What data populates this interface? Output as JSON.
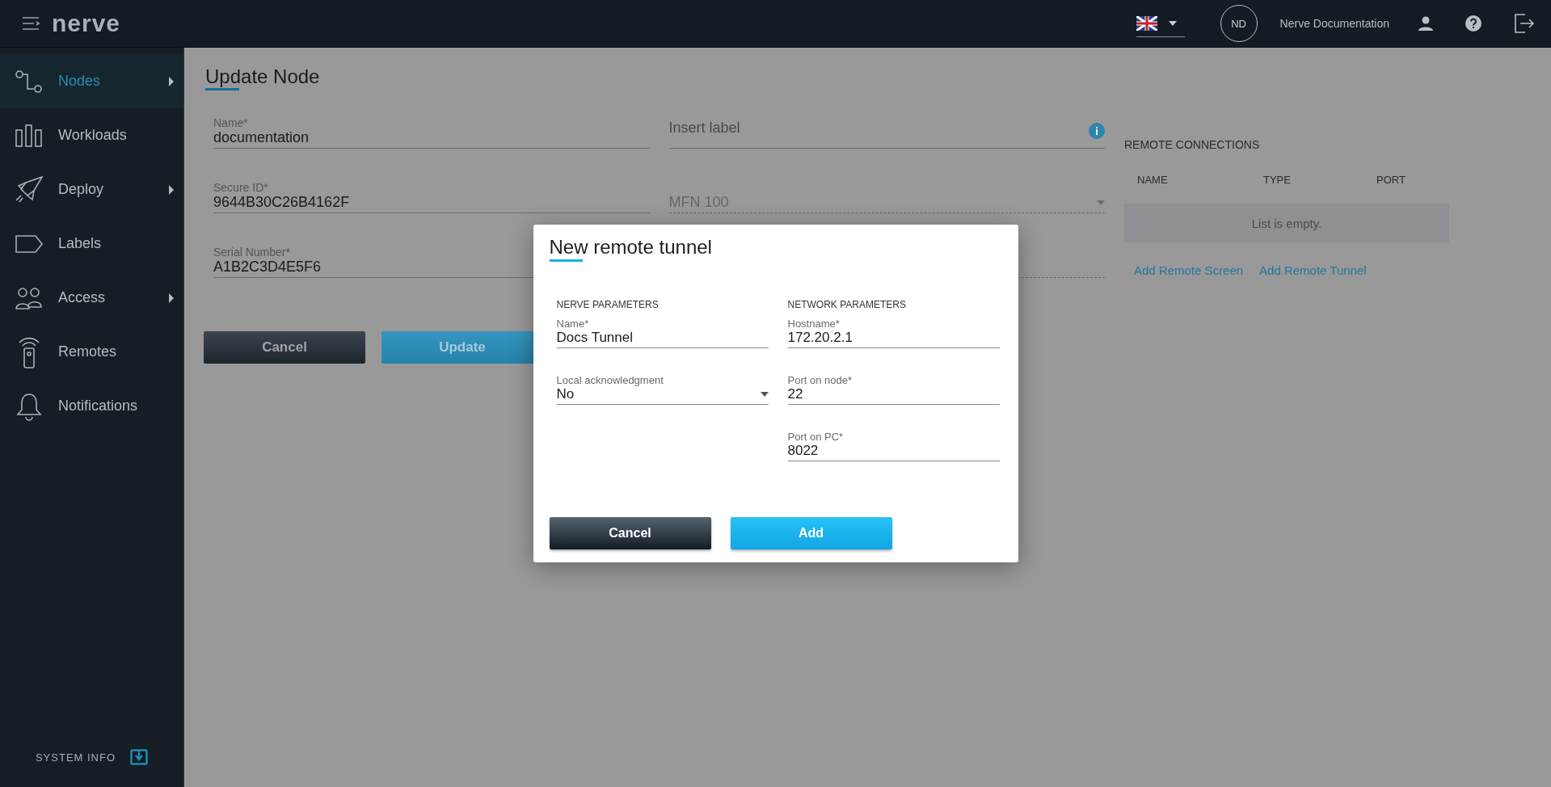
{
  "topbar": {
    "logo": "nerve",
    "language": {
      "expanded": false
    },
    "avatar": "ND",
    "user": "Nerve Documentation"
  },
  "sidebar": {
    "items": [
      {
        "label": "Nodes",
        "selected": true,
        "submenu": true
      },
      {
        "label": "Workloads",
        "selected": false,
        "submenu": false
      },
      {
        "label": "Deploy",
        "selected": false,
        "submenu": true
      },
      {
        "label": "Labels",
        "selected": false,
        "submenu": false
      },
      {
        "label": "Access",
        "selected": false,
        "submenu": true
      },
      {
        "label": "Remotes",
        "selected": false,
        "submenu": false
      },
      {
        "label": "Notifications",
        "selected": false,
        "submenu": false
      }
    ],
    "system_info": "SYSTEM INFO"
  },
  "page": {
    "title": "Update Node",
    "left_fields": [
      {
        "label": "Name*",
        "value": "documentation",
        "disabled": false
      },
      {
        "label": "Secure ID*",
        "value": "9644B30C26B4162F",
        "disabled": false
      },
      {
        "label": "Serial Number*",
        "value": "A1B2C3D4E5F6",
        "disabled": false
      }
    ],
    "right_fields": [
      {
        "kind": "info",
        "placeholder": "Insert label"
      },
      {
        "kind": "select",
        "value": "MFN 100",
        "disabled": true
      },
      {
        "kind": "text",
        "disabled": true
      }
    ],
    "buttons": [
      {
        "kind": "secondary",
        "label": "Cancel"
      },
      {
        "kind": "primary",
        "label": "Update"
      }
    ]
  },
  "remote_connections": {
    "title": "REMOTE CONNECTIONS",
    "columns": [
      "NAME",
      "TYPE",
      "PORT"
    ],
    "empty": "List is empty.",
    "links": [
      "Add Remote Screen",
      "Add Remote Tunnel"
    ]
  },
  "dialog": {
    "title": "New remote tunnel",
    "sections": [
      {
        "heading": "NERVE PARAMETERS",
        "fields": [
          {
            "kind": "text",
            "label": "Name*",
            "value": "Docs Tunnel"
          },
          {
            "kind": "select",
            "label": "Local acknowledgment",
            "value": "No"
          }
        ]
      },
      {
        "heading": "NETWORK PARAMETERS",
        "fields": [
          {
            "kind": "text",
            "label": "Hostname*",
            "value": "172.20.2.1"
          },
          {
            "kind": "text",
            "label": "Port on node*",
            "value": "22"
          },
          {
            "kind": "text",
            "label": "Port on PC*",
            "value": "8022"
          }
        ]
      }
    ],
    "buttons": [
      {
        "kind": "secondary",
        "label": "Cancel"
      },
      {
        "kind": "primary",
        "label": "Add"
      }
    ]
  }
}
